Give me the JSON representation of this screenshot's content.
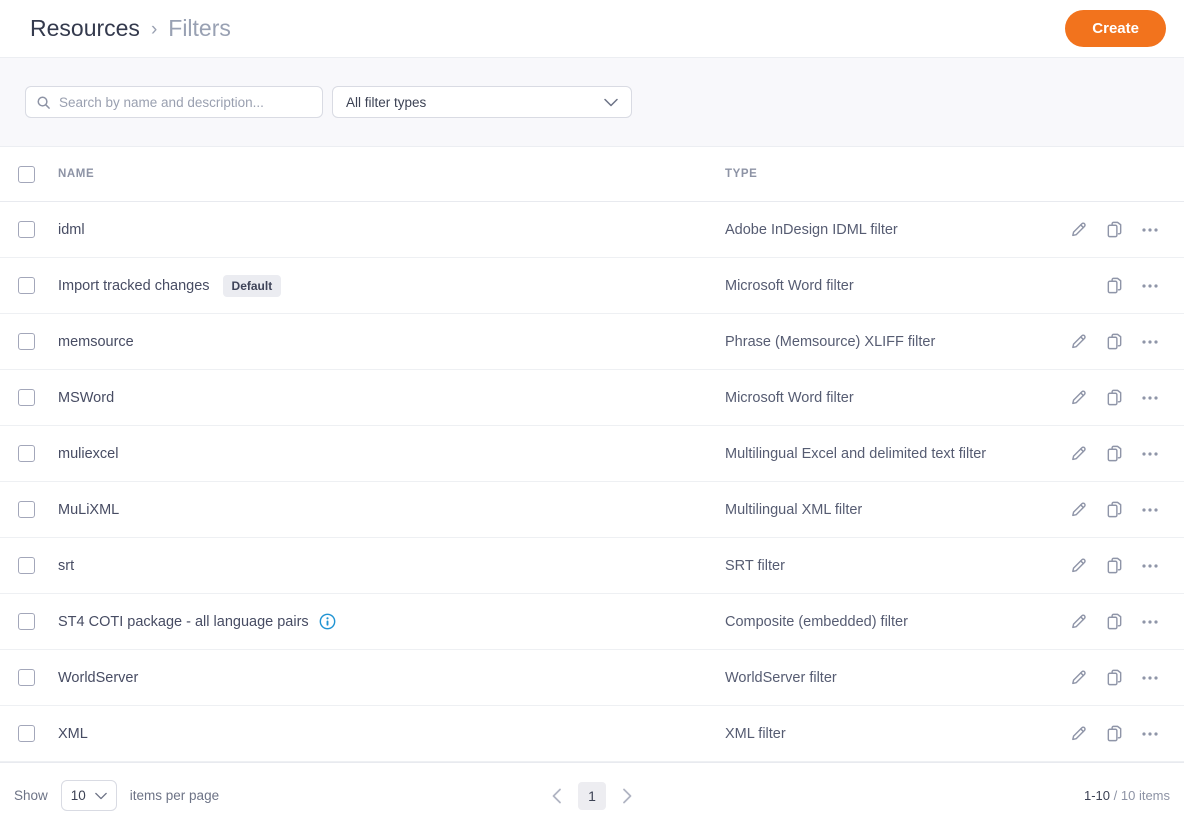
{
  "header": {
    "breadcrumb": {
      "parent": "Resources",
      "separator": "›",
      "current": "Filters"
    },
    "create_label": "Create"
  },
  "filters_bar": {
    "search_placeholder": "Search by name and description...",
    "type_filter_value": "All filter types"
  },
  "table": {
    "columns": {
      "name": "NAME",
      "type": "TYPE"
    },
    "rows": [
      {
        "name": "idml",
        "type": "Adobe InDesign IDML filter",
        "badge": "",
        "has_edit": true,
        "has_info": false
      },
      {
        "name": "Import tracked changes",
        "type": "Microsoft Word filter",
        "badge": "Default",
        "has_edit": false,
        "has_info": false
      },
      {
        "name": "memsource",
        "type": "Phrase (Memsource) XLIFF filter",
        "badge": "",
        "has_edit": true,
        "has_info": false
      },
      {
        "name": "MSWord",
        "type": "Microsoft Word filter",
        "badge": "",
        "has_edit": true,
        "has_info": false
      },
      {
        "name": "muliexcel",
        "type": "Multilingual Excel and delimited text filter",
        "badge": "",
        "has_edit": true,
        "has_info": false
      },
      {
        "name": "MuLiXML",
        "type": "Multilingual XML filter",
        "badge": "",
        "has_edit": true,
        "has_info": false
      },
      {
        "name": "srt",
        "type": "SRT filter",
        "badge": "",
        "has_edit": true,
        "has_info": false
      },
      {
        "name": "ST4 COTI package - all language pairs",
        "type": "Composite (embedded) filter",
        "badge": "",
        "has_edit": true,
        "has_info": true
      },
      {
        "name": "WorldServer",
        "type": "WorldServer filter",
        "badge": "",
        "has_edit": true,
        "has_info": false
      },
      {
        "name": "XML",
        "type": "XML filter",
        "badge": "",
        "has_edit": true,
        "has_info": false
      }
    ]
  },
  "footer": {
    "show_label": "Show",
    "page_size": "10",
    "per_page_label": "items per page",
    "current_page": "1",
    "range": "1-10",
    "total": " / 10 items"
  },
  "colors": {
    "accent_orange": "#f2731d",
    "info_blue": "#2094d3",
    "filter_bar_bg": "#f8f8fb"
  }
}
